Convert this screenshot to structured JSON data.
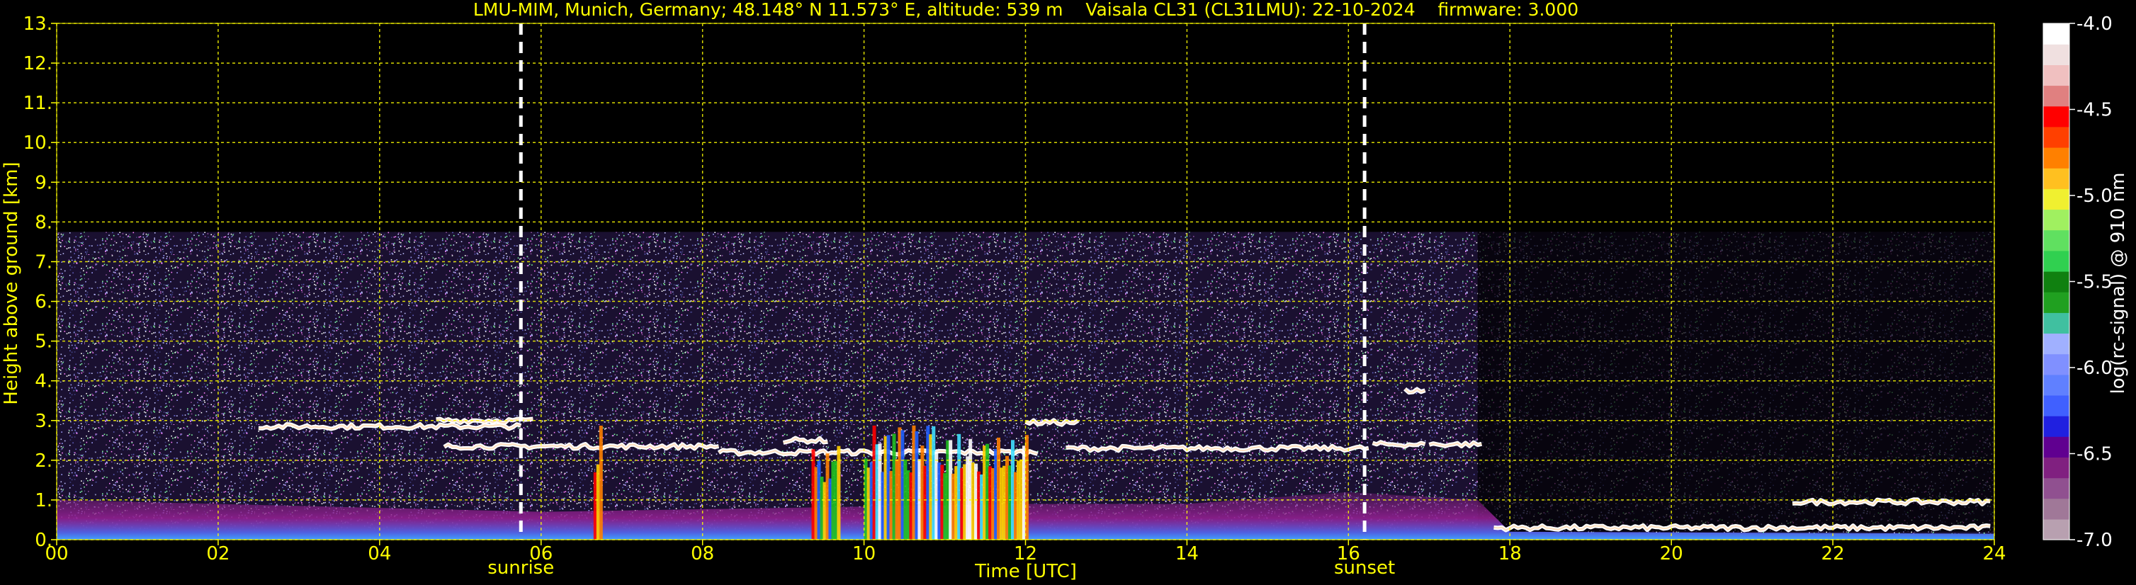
{
  "header": {
    "title": "LMU-MIM, Munich, Germany; 48.148° N 11.573° E, altitude: 539 m    Vaisala CL31 (CL31LMU): 22-10-2024    firmware: 3.000"
  },
  "chart_data": {
    "type": "heatmap",
    "title": "LMU-MIM, Munich, Germany; 48.148° N 11.573° E, altitude: 539 m    Vaisala CL31 (CL31LMU): 22-10-2024    firmware: 3.000",
    "xlabel": "Time [UTC]",
    "ylabel": "Height above ground [km]",
    "x_ticks": [
      "00",
      "02",
      "04",
      "06",
      "08",
      "10",
      "12",
      "14",
      "16",
      "18",
      "20",
      "22",
      "24"
    ],
    "y_ticks": [
      "0.",
      "1.",
      "2.",
      "3.",
      "4.",
      "5.",
      "6.",
      "7.",
      "8.",
      "9.",
      "10.",
      "11.",
      "12.",
      "13."
    ],
    "xlim": [
      0,
      24
    ],
    "ylim": [
      0,
      13
    ],
    "grid": true,
    "grid_color": "#ffff00",
    "text_color": "#ffff00",
    "colorbar": {
      "label": "log(rc-signal) @ 910 nm",
      "ticks": [
        "-4.0",
        "-4.5",
        "-5.0",
        "-5.5",
        "-6.0",
        "-6.5",
        "-7.0"
      ],
      "range": [
        -7.0,
        -4.0
      ],
      "colors": [
        "#b8a0b0",
        "#a07898",
        "#905090",
        "#802080",
        "#600090",
        "#2020e0",
        "#4060ff",
        "#6080ff",
        "#8090ff",
        "#a0b0ff",
        "#40c0a0",
        "#20a020",
        "#108010",
        "#30d050",
        "#60e060",
        "#a0f060",
        "#f0f030",
        "#ffc020",
        "#ff8000",
        "#ff4000",
        "#ff0000",
        "#e08080",
        "#f0c0c0",
        "#f0e0e0",
        "#ffffff"
      ]
    },
    "events": [
      {
        "label": "sunrise",
        "time": 5.75
      },
      {
        "label": "sunset",
        "time": 16.2
      }
    ],
    "noise_top_km": 7.75,
    "cloud_layers": [
      {
        "t": [
          2.5,
          5.75
        ],
        "h": 2.85
      },
      {
        "t": [
          4.7,
          5.9
        ],
        "h": 3.0
      },
      {
        "t": [
          4.8,
          8.2
        ],
        "h": 2.35
      },
      {
        "t": [
          8.2,
          12.2
        ],
        "h": 2.2
      },
      {
        "t": [
          9.0,
          9.6
        ],
        "h": 2.5
      },
      {
        "t": [
          12.0,
          12.7
        ],
        "h": 2.95
      },
      {
        "t": [
          12.5,
          16.3
        ],
        "h": 2.3
      },
      {
        "t": [
          16.3,
          17.0
        ],
        "h": 2.4
      },
      {
        "t": [
          16.7,
          17.0
        ],
        "h": 3.75
      },
      {
        "t": [
          17.0,
          17.7
        ],
        "h": 2.4
      },
      {
        "t": [
          17.8,
          24.0
        ],
        "h": 0.3
      },
      {
        "t": [
          21.5,
          24.0
        ],
        "h": 0.95
      }
    ],
    "precipitation": [
      {
        "t": [
          9.35,
          9.7
        ],
        "top": 2.6
      },
      {
        "t": [
          10.0,
          12.0
        ],
        "top": 2.9
      },
      {
        "t": [
          6.65,
          6.75
        ],
        "top": 3.0
      }
    ],
    "boundary_layer_top_km": [
      [
        0,
        1.0
      ],
      [
        4,
        0.8
      ],
      [
        6,
        0.7
      ],
      [
        9,
        0.8
      ],
      [
        12,
        0.9
      ],
      [
        14,
        0.9
      ],
      [
        16,
        1.2
      ],
      [
        17.6,
        1.0
      ],
      [
        18,
        0.2
      ],
      [
        24,
        0.15
      ]
    ]
  }
}
